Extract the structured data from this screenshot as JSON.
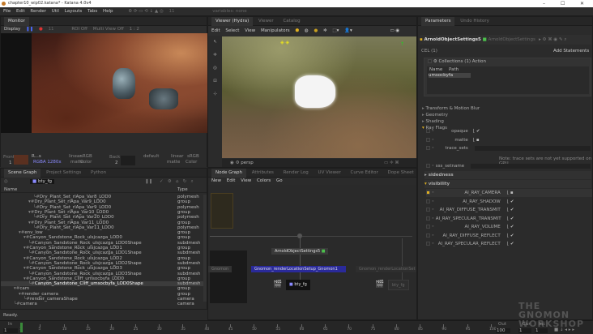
{
  "window": {
    "title": "chapter10_wip02.katana* - Katana 4.0v4",
    "controls": [
      "–",
      "☐",
      "✕"
    ]
  },
  "menubar": {
    "items": [
      "File",
      "Edit",
      "Render",
      "Util",
      "Layouts",
      "Tabs",
      "Help"
    ],
    "frame": "11",
    "variables": "variables: none"
  },
  "monitor": {
    "tab": "Monitor",
    "toolbar": {
      "display": "Display",
      "frame": "11",
      "roi": "ROI Off",
      "multiview": "Multi View Off",
      "ratio": "1 : 2"
    },
    "front_label": "Front",
    "front_value": "1",
    "back_label": "Back",
    "back_value": "2",
    "image_name": "R...s",
    "image_info": "RGBA 1280x",
    "lut1": "linear",
    "lut2": "sRGB",
    "matte": "matte",
    "color": "Color",
    "default": "default"
  },
  "scenegraph": {
    "tabs": [
      "Scene Graph",
      "Project Settings",
      "Python"
    ],
    "filter": "bty_fg",
    "col_name": "Name",
    "col_type": "Type",
    "rows": [
      {
        "name": "Dry_Plant_Set_rlApa_Var8_LOD0",
        "type": "polymesh",
        "indent": 5
      },
      {
        "name": "Dry_Plant_Set_rlApa_Var9_LOD0",
        "type": "group",
        "indent": 4
      },
      {
        "name": "Dry_Plant_Set_rlApa_Var9_LOD0",
        "type": "polymesh",
        "indent": 5
      },
      {
        "name": "Dry_Plant_Set_rlApa_Var10_LOD0",
        "type": "group",
        "indent": 4
      },
      {
        "name": "Dry_Plant_Set_rlApa_Var20_LOD0",
        "type": "polymesh",
        "indent": 5
      },
      {
        "name": "Dry_Plant_Set_rlApa_Var11_LOD0",
        "type": "group",
        "indent": 4
      },
      {
        "name": "Dry_Plant_Set_rlApa_Var11_LOD0",
        "type": "polymesh",
        "indent": 5
      },
      {
        "name": "env_low",
        "type": "group",
        "indent": 2
      },
      {
        "name": "Canyon_Sandstone_Rock_ulsjcazga_LOD0",
        "type": "group",
        "indent": 3
      },
      {
        "name": "Canyon_Sandstone_Rock_ulsjcazga_LOD0Shape",
        "type": "subdmesh",
        "indent": 4
      },
      {
        "name": "Canyon_Sandstone_Rock_ulsjcazga_LOD1",
        "type": "group",
        "indent": 3
      },
      {
        "name": "Canyon_Sandstone_Rock_ulsjcazga_LOD1Shape",
        "type": "subdmesh",
        "indent": 4
      },
      {
        "name": "Canyon_Sandstone_Rock_ulsjcazga_LOD2",
        "type": "group",
        "indent": 3
      },
      {
        "name": "Canyon_Sandstone_Rock_ulsjcazga_LOD2Shape",
        "type": "subdmesh",
        "indent": 4
      },
      {
        "name": "Canyon_Sandstone_Rock_ulsjcazga_LOD3",
        "type": "group",
        "indent": 3
      },
      {
        "name": "Canyon_Sandstone_Rock_ulsjcazga_LOD3Shape",
        "type": "subdmesh",
        "indent": 4
      },
      {
        "name": "Canyon_Sandstone_Cliff_umsocbyfa_LOD0",
        "type": "group",
        "indent": 3
      },
      {
        "name": "Canyon_Sandstone_Cliff_umsocbyfa_LOD0Shape",
        "type": "subdmesh",
        "indent": 4,
        "selected": true
      },
      {
        "name": "cam",
        "type": "group",
        "indent": 1
      },
      {
        "name": "render_camera",
        "type": "group",
        "indent": 2
      },
      {
        "name": "render_cameraShape",
        "type": "camera",
        "indent": 3
      },
      {
        "name": "camera",
        "type": "camera",
        "indent": 1
      }
    ],
    "status": "Ready."
  },
  "viewer": {
    "tabs": [
      "Viewer (Hydra)",
      "Viewer",
      "Catalog"
    ],
    "menu": [
      "Edit",
      "Select",
      "View",
      "Manipulators"
    ],
    "camera": "persp"
  },
  "nodegraph": {
    "tabs": [
      "Node Graph",
      "Attributes",
      "Render Log",
      "UV Viewer",
      "Curve Editor",
      "Dope Sheet"
    ],
    "menu": [
      "New",
      "Edit",
      "View",
      "Colors",
      "Go"
    ],
    "nodes": {
      "arnold": "ArnoldObjectSettings5",
      "setup": "Gnomon_renderLocationSetup_Gnomon1",
      "setup2": "Gnomon_renderLocationSet",
      "gnomon": "Gnomon",
      "bty": "bty_fg",
      "bty2": "bty_fg"
    }
  },
  "parameters": {
    "tabs": [
      "Parameters",
      "Undo History"
    ],
    "node_name": "ArnoldObjectSettings5",
    "node_type": "ArnoldObjectSettings",
    "cel": "CEL (1)",
    "add_statements": "Add Statements",
    "collections": "Collections (1)",
    "action": "Action",
    "col_name": "Name",
    "col_path": "Path",
    "collection_value": "umsocbyfa",
    "groups": [
      "Transform & Motion Blur",
      "Geometry",
      "Shading",
      "Ray Flags"
    ],
    "ray_flags": [
      {
        "label": "opaque",
        "checked": true
      },
      {
        "label": "matte",
        "checked": false
      },
      {
        "label": "trace_sets"
      }
    ],
    "note": "Note: trace sets are not yet supported on GPU",
    "sss": "sss_setname",
    "sidedness": "sidedness",
    "visibility": "visibility",
    "visibility_rows": [
      {
        "label": "AI_RAY_CAMERA",
        "checked": false
      },
      {
        "label": "AI_RAY_SHADOW",
        "checked": true
      },
      {
        "label": "AI_RAY_DIFFUSE_TRANSMIT",
        "checked": true
      },
      {
        "label": "AI_RAY_SPECULAR_TRANSMIT",
        "checked": true
      },
      {
        "label": "AI_RAY_VOLUME",
        "checked": true
      },
      {
        "label": "AI_RAY_DIFFUSE_REFLECT",
        "checked": true
      },
      {
        "label": "AI_RAY_SPECULAR_REFLECT",
        "checked": true
      }
    ]
  },
  "timeline": {
    "in_label": "In",
    "in_value": "1",
    "out_label": "Out",
    "out_value": "100",
    "cur_label": "Cur",
    "cur_value": "1",
    "inc_label": "Inc",
    "inc_value": "1",
    "start": 1,
    "end": 100,
    "current": 1
  },
  "watermark": "THE GNOMON WORKSHOP",
  "colors": {
    "accent": "#e0b020",
    "selection": "#2a2a9a",
    "green": "#4cbf4c"
  }
}
